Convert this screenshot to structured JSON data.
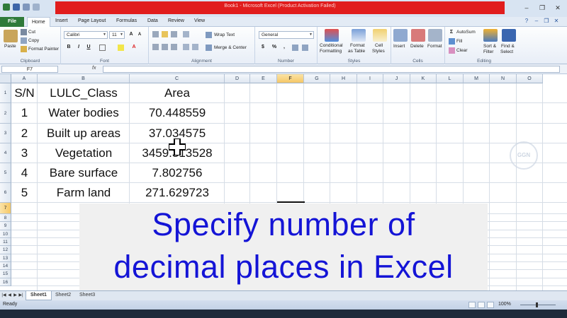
{
  "window": {
    "title": "Book1 - Microsoft Excel (Product Activation Failed)",
    "min_icon": "minimize-icon",
    "restore_icon": "restore-icon",
    "close_icon": "close-icon"
  },
  "tabs": [
    "File",
    "Home",
    "Insert",
    "Page Layout",
    "Formulas",
    "Data",
    "Review",
    "View"
  ],
  "active_tab": "Home",
  "ribbon": {
    "clipboard": {
      "paste": "Paste",
      "cut": "Cut",
      "copy": "Copy",
      "format_painter": "Format Painter",
      "label": "Clipboard"
    },
    "font": {
      "name": "Calibri",
      "size": "11",
      "bold": "B",
      "italic": "I",
      "underline": "U",
      "label": "Font"
    },
    "alignment": {
      "wrap": "Wrap Text",
      "merge": "Merge & Center",
      "label": "Alignment"
    },
    "number": {
      "format": "General",
      "currency": "$",
      "percent": "%",
      "comma": ",",
      "label": "Number"
    },
    "styles": {
      "conditional": [
        "Conditional",
        "Formatting"
      ],
      "table": [
        "Format",
        "as Table"
      ],
      "cell": [
        "Cell",
        "Styles"
      ],
      "label": "Styles"
    },
    "cells": {
      "insert": "Insert",
      "delete": "Delete",
      "format": "Format",
      "label": "Cells"
    },
    "editing": {
      "autosum": "AutoSum",
      "fill": "Fill",
      "clear": "Clear",
      "sort": [
        "Sort &",
        "Filter"
      ],
      "find": [
        "Find &",
        "Select"
      ],
      "label": "Editing"
    }
  },
  "formula_bar": {
    "name_box": "F7",
    "fx": "fx",
    "formula": ""
  },
  "columns": [
    "A",
    "B",
    "C",
    "D",
    "E",
    "F",
    "G",
    "H",
    "I",
    "J",
    "K",
    "L",
    "M",
    "N",
    "O"
  ],
  "selected_column": "F",
  "rows": [
    "1",
    "2",
    "3",
    "4",
    "5",
    "6",
    "7",
    "8",
    "9",
    "10",
    "11",
    "12",
    "13",
    "14",
    "15",
    "16"
  ],
  "selected_row": "7",
  "sheet": {
    "headers": [
      "S/N",
      "LULC_Class",
      "Area"
    ],
    "data": [
      [
        "1",
        "Water bodies",
        "70.448559"
      ],
      [
        "2",
        "Built up areas",
        "37.034575"
      ],
      [
        "3",
        "Vegetation",
        "3459.313528"
      ],
      [
        "4",
        "Bare surface",
        "7.802756"
      ],
      [
        "5",
        "Farm land",
        "271.629723"
      ]
    ]
  },
  "banner": {
    "line1": "Specify number of",
    "line2": "decimal places in Excel"
  },
  "watermark": "GGN",
  "sheet_tabs": [
    "Sheet1",
    "Sheet2",
    "Sheet3"
  ],
  "active_sheet": "Sheet1",
  "status": {
    "ready": "Ready",
    "zoom": "100%"
  },
  "colors": {
    "title_red": "#e11d1d",
    "file_tab_green": "#2f7a3a",
    "banner_text": "#1414d6",
    "selected_header": "#f5c766"
  }
}
